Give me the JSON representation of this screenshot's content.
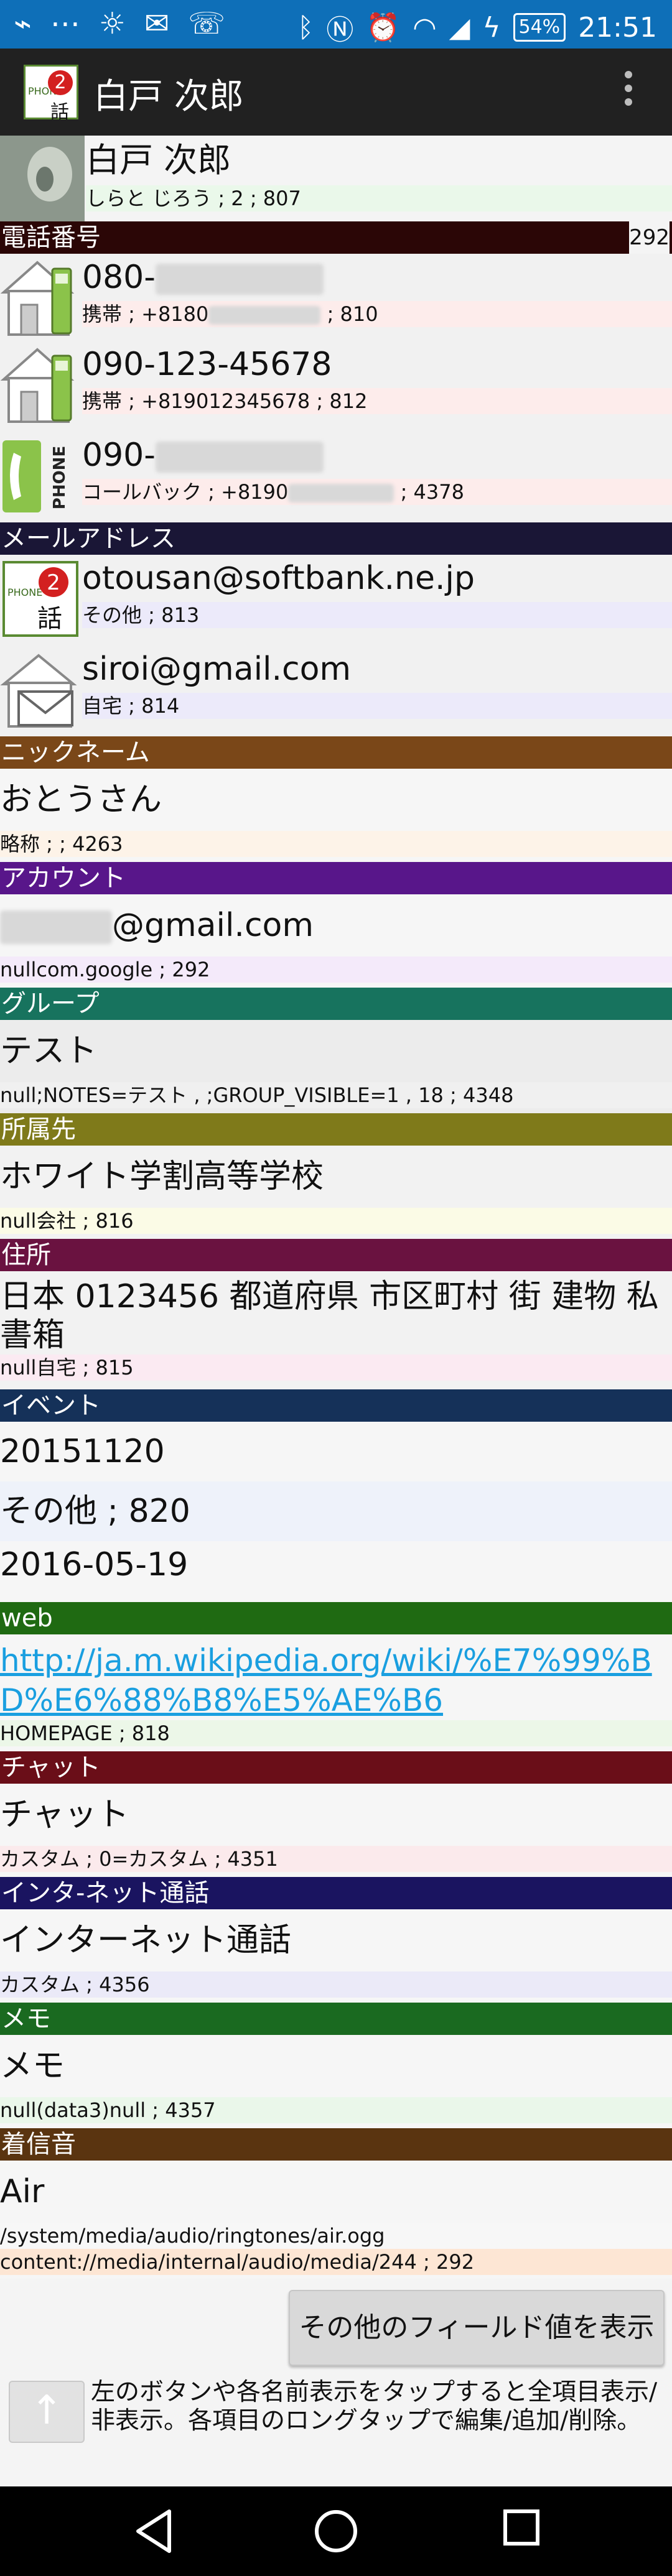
{
  "status": {
    "battery": "54%",
    "time": "21:51"
  },
  "app": {
    "title": "白戸 次郎",
    "icon_text": "話",
    "icon_badge": "2"
  },
  "contact": {
    "name": "白戸 次郎",
    "detail": "しらと じろう ; 2 ; 807"
  },
  "sections": {
    "phone": {
      "title": "電話番号",
      "count": "292"
    },
    "email": {
      "title": "メールアドレス"
    },
    "nickname": {
      "title": "ニックネーム"
    },
    "account": {
      "title": "アカウント"
    },
    "group": {
      "title": "グループ"
    },
    "org": {
      "title": "所属先"
    },
    "address": {
      "title": "住所"
    },
    "event": {
      "title": "イベント"
    },
    "web": {
      "title": "web"
    },
    "chat": {
      "title": "チャット"
    },
    "sip": {
      "title": "インタ-ネット通話"
    },
    "memo": {
      "title": "メモ"
    },
    "ringtone": {
      "title": "着信音"
    }
  },
  "phones": [
    {
      "number": "080-",
      "sub_a": "携帯 ; +8180",
      "sub_b": "; 810"
    },
    {
      "number": "090-123-45678",
      "sub_a": "携帯 ; +819012345678 ; 812",
      "sub_b": ""
    },
    {
      "number": "090-",
      "sub_a": "コールバック ; +8190",
      "sub_b": "; 4378"
    }
  ],
  "emails": [
    {
      "address": "otousan@softbank.ne.jp",
      "detail": "その他 ; 813"
    },
    {
      "address": "siroi@gmail.com",
      "detail": "自宅 ; 814"
    }
  ],
  "nickname": {
    "value": "おとうさん",
    "detail": "略称 ; ; 4263"
  },
  "account": {
    "value": "@gmail.com",
    "detail": "nullcom.google ; 292"
  },
  "group": {
    "value": "テスト",
    "detail": "null;NOTES=テスト , ;GROUP_VISIBLE=1 , 18 ; 4348"
  },
  "org": {
    "value": "ホワイト学割高等学校",
    "detail": "null会社 ; 816"
  },
  "address": {
    "value": "日本 0123456 都道府県 市区町村 街 建物 私書箱",
    "detail": "null自宅 ; 815"
  },
  "events": [
    {
      "value": "20151120"
    },
    {
      "value": "その他 ; 820"
    },
    {
      "value": "2016-05-19"
    }
  ],
  "web": {
    "url": "http://ja.m.wikipedia.org/wiki/%E7%99%BD%E6%88%B8%E5%AE%B6",
    "detail": "HOMEPAGE ; 818"
  },
  "chat": {
    "value": "チャット",
    "detail": "カスタム ; 0=カスタム ; 4351"
  },
  "sip": {
    "value": "インターネット通話",
    "detail": "カスタム ; 4356"
  },
  "memo": {
    "value": "メモ",
    "detail": "null(data3)null ; 4357"
  },
  "ringtone": {
    "value": "Air",
    "path": "/system/media/audio/ringtones/air.ogg",
    "uri": "content://media/internal/audio/media/244 ; 292"
  },
  "footer": {
    "show_button": "その他のフィールド値を表示",
    "help": "左のボタンや各名前表示をタップすると全項目表示/非表示。各項目のロングタップで編集/追加/削除。",
    "up_glyph": "↑"
  },
  "colors": {
    "phone": "#2b0606",
    "email": "#1a1636",
    "nickname": "#7a4718",
    "account": "#58168a",
    "group": "#17735e",
    "org": "#7f7a1a",
    "address": "#6a1240",
    "event": "#153159",
    "web": "#1f6a12",
    "chat": "#6a0e18",
    "sip": "#1a1460",
    "memo": "#1a6a20",
    "ringtone": "#5a3410"
  }
}
